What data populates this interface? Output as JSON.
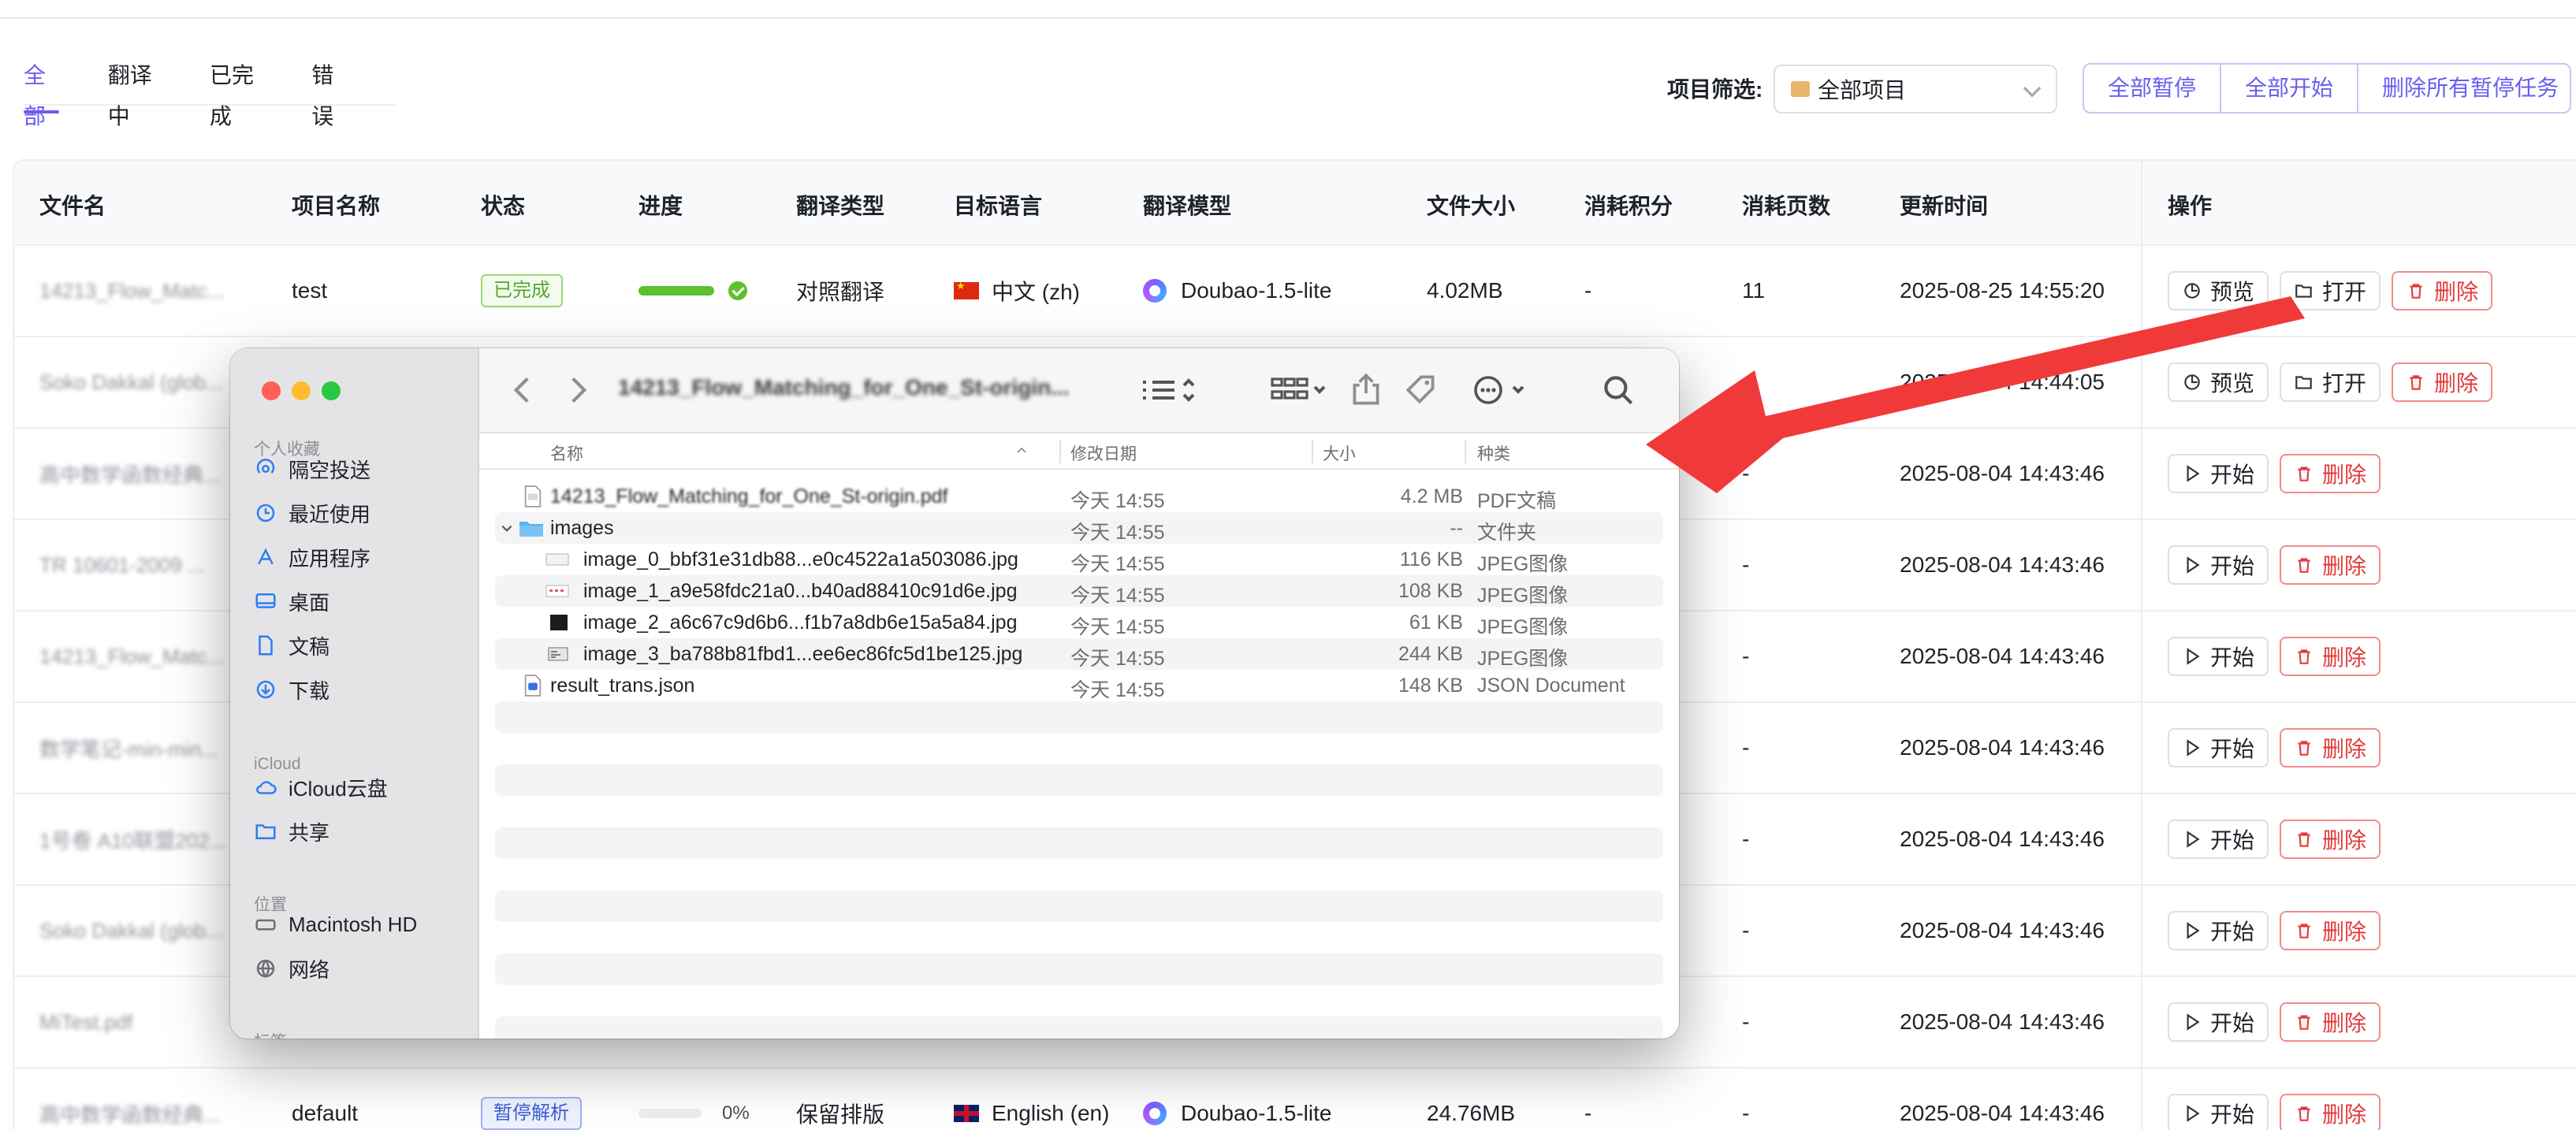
{
  "tabs": [
    {
      "label": "全部",
      "active": true
    },
    {
      "label": "翻译中",
      "active": false
    },
    {
      "label": "已完成",
      "active": false
    },
    {
      "label": "错误",
      "active": false
    }
  ],
  "filter": {
    "label": "项目筛选:",
    "selected": "全部项目"
  },
  "bulk_actions": {
    "pause_all": "全部暂停",
    "start_all": "全部开始",
    "delete_paused": "删除所有暂停任务"
  },
  "table": {
    "headers": {
      "filename": "文件名",
      "project": "项目名称",
      "status": "状态",
      "progress": "进度",
      "translate_type": "翻译类型",
      "target_lang": "目标语言",
      "model": "翻译模型",
      "size": "文件大小",
      "credits": "消耗积分",
      "pages": "消耗页数",
      "updated": "更新时间",
      "ops": "操作"
    },
    "rows": [
      {
        "filename": "14213_Flow_Matc...",
        "project": "test",
        "status": "已完成",
        "progress": 100,
        "translate_type": "对照翻译",
        "target_lang": "中文 (zh)",
        "model": "Doubao-1.5-lite",
        "size": "4.02MB",
        "credits": "-",
        "pages": "11",
        "updated": "2025-08-25 14:55:20",
        "actions": [
          "预览",
          "打开",
          "删除"
        ]
      },
      {
        "filename": "Soko Dakkal (glob...",
        "credits": "-",
        "updated": "2025-08-04 14:44:05",
        "actions": [
          "预览",
          "打开",
          "删除"
        ]
      },
      {
        "filename": "高中数学函数经典...",
        "credits": "-",
        "updated": "2025-08-04 14:43:46",
        "actions": [
          "开始",
          "删除"
        ]
      },
      {
        "filename": "TR 10601-2009 ...",
        "credits": "-",
        "updated": "2025-08-04 14:43:46",
        "actions": [
          "开始",
          "删除"
        ]
      },
      {
        "filename": "14213_Flow_Matc...",
        "credits": "-",
        "updated": "2025-08-04 14:43:46",
        "actions": [
          "开始",
          "删除"
        ]
      },
      {
        "filename": "数学笔记-min-min...",
        "credits": "-",
        "updated": "2025-08-04 14:43:46",
        "actions": [
          "开始",
          "删除"
        ]
      },
      {
        "filename": "1号卷 A10联盟202...",
        "credits": "-",
        "updated": "2025-08-04 14:43:46",
        "actions": [
          "开始",
          "删除"
        ]
      },
      {
        "filename": "Soko Dakkal (glob...",
        "credits": "-",
        "updated": "2025-08-04 14:43:46",
        "actions": [
          "开始",
          "删除"
        ]
      },
      {
        "filename": "MiTest.pdf",
        "credits": "-",
        "updated": "2025-08-04 14:43:46",
        "actions": [
          "开始",
          "删除"
        ]
      },
      {
        "filename": "高中数学函数经典...",
        "project": "default",
        "status": "暂停解析",
        "progress": 0,
        "progress_label": "0%",
        "translate_type": "保留排版",
        "target_lang": "English (en)",
        "model": "Doubao-1.5-lite",
        "size": "24.76MB",
        "credits": "-",
        "pages": "-",
        "updated": "2025-08-04 14:43:46",
        "actions": [
          "开始",
          "删除"
        ]
      }
    ]
  },
  "finder": {
    "title": "14213_Flow_Matching_for_One_St-origin...",
    "sidebar": {
      "favorites_label": "个人收藏",
      "favorites": [
        {
          "label": "隔空投送",
          "icon": "airdrop-icon"
        },
        {
          "label": "最近使用",
          "icon": "clock-icon"
        },
        {
          "label": "应用程序",
          "icon": "apps-icon"
        },
        {
          "label": "桌面",
          "icon": "desktop-icon"
        },
        {
          "label": "文稿",
          "icon": "document-icon"
        },
        {
          "label": "下载",
          "icon": "download-icon"
        }
      ],
      "icloud_label": "iCloud",
      "icloud": [
        {
          "label": "iCloud云盘",
          "icon": "cloud-icon"
        },
        {
          "label": "共享",
          "icon": "shared-folder-icon"
        }
      ],
      "locations_label": "位置",
      "locations": [
        {
          "label": "Macintosh HD",
          "icon": "disk-icon"
        },
        {
          "label": "网络",
          "icon": "globe-icon"
        }
      ],
      "tags_label": "标签"
    },
    "columns": {
      "name": "名称",
      "modified": "修改日期",
      "size": "大小",
      "kind": "种类"
    },
    "files": [
      {
        "name": "14213_Flow_Matching_for_One_St-origin.pdf",
        "modified": "今天 14:55",
        "size": "4.2 MB",
        "kind": "PDF文稿",
        "type": "pdf",
        "indent": 0
      },
      {
        "name": "images",
        "modified": "今天 14:55",
        "size": "--",
        "kind": "文件夹",
        "type": "folder",
        "indent": 0
      },
      {
        "name": "image_0_bbf31e31db88...e0c4522a1a503086.jpg",
        "modified": "今天 14:55",
        "size": "116 KB",
        "kind": "JPEG图像",
        "type": "jpg",
        "indent": 1
      },
      {
        "name": "image_1_a9e58fdc21a0...b40ad88410c91d6e.jpg",
        "modified": "今天 14:55",
        "size": "108 KB",
        "kind": "JPEG图像",
        "type": "jpg",
        "indent": 1
      },
      {
        "name": "image_2_a6c67c9d6b6...f1b7a8db6e15a5a84.jpg",
        "modified": "今天 14:55",
        "size": "61 KB",
        "kind": "JPEG图像",
        "type": "jpg-dark",
        "indent": 1
      },
      {
        "name": "image_3_ba788b81fbd1...ee6ec86fc5d1be125.jpg",
        "modified": "今天 14:55",
        "size": "244 KB",
        "kind": "JPEG图像",
        "type": "jpg",
        "indent": 1
      },
      {
        "name": "result_trans.json",
        "modified": "今天 14:55",
        "size": "148 KB",
        "kind": "JSON Document",
        "type": "json",
        "indent": 0
      }
    ]
  },
  "colors": {
    "accent": "#6b5cf0",
    "success": "#5ec02b",
    "danger": "#e23b3b",
    "arrow": "#f03a3a"
  }
}
